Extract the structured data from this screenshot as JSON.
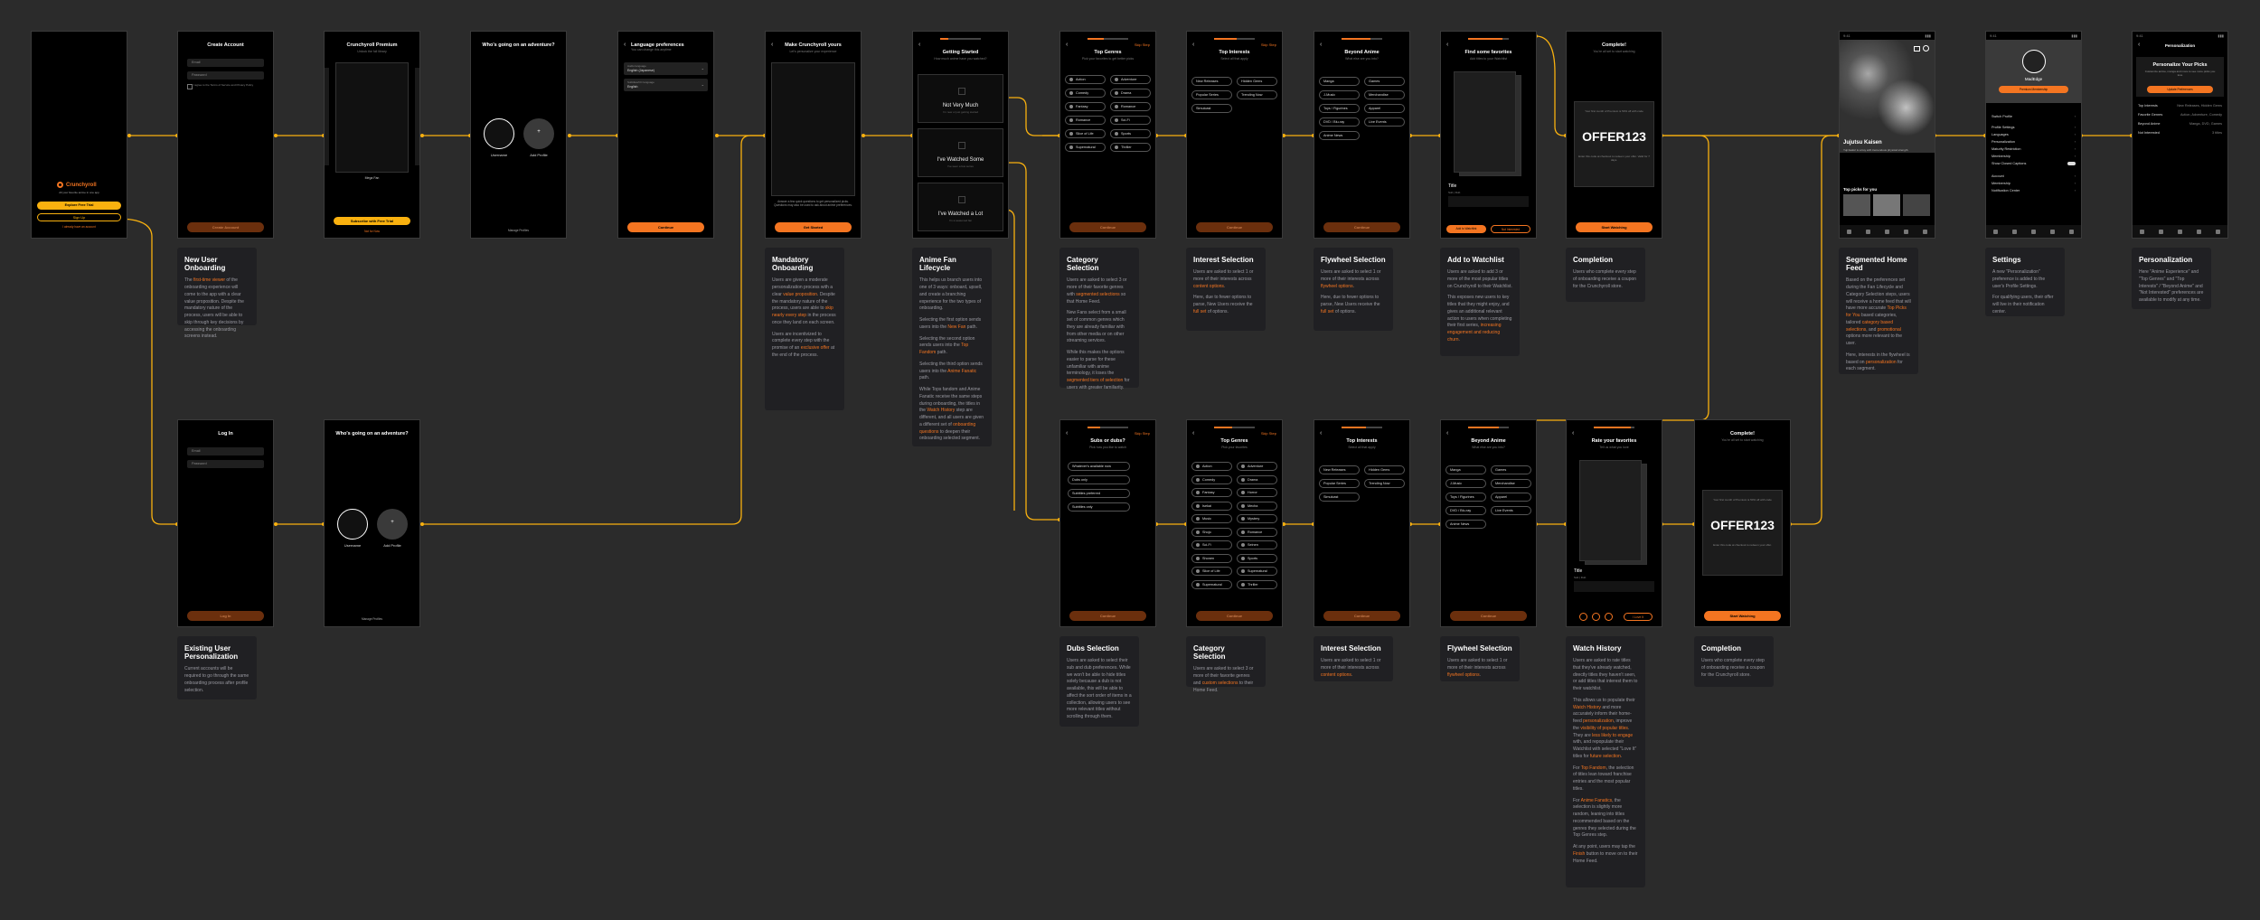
{
  "colors": {
    "bg": "#2b2b2b",
    "accent": "#f47521",
    "yellow": "#f9b10f",
    "line": "#f9b10f"
  },
  "screens": {
    "s1": {
      "brand": "Crunchyroll",
      "tagline": "All your favorite anime in one app",
      "primary": "Explore Free Trial",
      "secondary": "Sign Up",
      "link": "I already have an account"
    },
    "s2": {
      "title": "Create Account",
      "email": "Email",
      "password": "Password",
      "terms": "I agree to the Terms of Service and Privacy Policy",
      "cta": "Create Account"
    },
    "s3": {
      "title": "Crunchyroll Premium",
      "sub": "Unlock the full library",
      "plan": "Mega Fan",
      "cta": "Subscribe with Free Trial",
      "link": "Not for Now"
    },
    "s4": {
      "title": "Who's going on an adventure?",
      "u1": "Username",
      "u2": "Add Profile",
      "manage": "Manage Profiles"
    },
    "s5": {
      "title": "Language preferences",
      "sub": "You can change this anytime",
      "f1l": "Audio language",
      "f1v": "English (Japanese)",
      "f2l": "Subtitles/CC language",
      "f2v": "English",
      "cta": "Continue"
    },
    "s6": {
      "title": "Make Crunchyroll yours",
      "sub": "Let's personalize your experience",
      "body": "Answer a few quick questions to get personalized picks. Questions may also be used to ask about anime preferences.",
      "cta": "Get Started"
    },
    "s7": {
      "title": "Getting Started",
      "sub": "How much anime have you watched?",
      "o1": "Not Very Much",
      "o1s": "I'm new or just getting started",
      "o2": "I've Watched Some",
      "o2s": "I've seen a few series",
      "o3": "I've Watched a Lot",
      "o3s": "I'm a seasoned fan"
    },
    "s8": {
      "title": "Top Genres",
      "sub": "Pick your favorites to get better picks",
      "skip": "Skip Step",
      "chips": [
        "Action",
        "Adventure",
        "Comedy",
        "Drama",
        "Fantasy",
        "Romance",
        "Romance",
        "Sci-Fi",
        "Slice of Life",
        "Sports",
        "Supernatural",
        "Thriller"
      ],
      "cta": "Continue"
    },
    "s9": {
      "title": "Top Interests",
      "sub": "Select all that apply",
      "skip": "Skip Step",
      "chips": [
        "New Releases",
        "Hidden Gems",
        "Popular Series",
        "Trending Now",
        "Simulcast"
      ],
      "cta": "Continue"
    },
    "s10": {
      "title": "Beyond Anime",
      "sub": "What else are you into?",
      "chips": [
        "Manga",
        "Games",
        "J-Music",
        "Merchandise",
        "Toys / Figurines",
        "Apparel",
        "DVD / Blu-ray",
        "Live Events",
        "Anime News"
      ],
      "cta": "Continue"
    },
    "s11": {
      "title": "Find some favorites",
      "sub": "Add titles to your Watchlist",
      "ttl": "Title",
      "meta": "Sub | Dub",
      "a1": "Add to Watchlist",
      "a2": "Not Interested"
    },
    "s12": {
      "title": "Complete!",
      "sub": "You're all set to start watching",
      "o1": "Your first month of Premium is 50% off with code",
      "code": "OFFER123",
      "o2": "Enter this code at checkout to redeem your offer. Valid for 7 days.",
      "cta": "Start Watching"
    },
    "s13": {
      "show": "Jujutsu Kaisen",
      "desc": "Yuji Itadori is a boy with tremendous physical strength.",
      "row": "Top picks for you"
    },
    "s14": {
      "user": "MadEdge",
      "cta": "Premium Membership",
      "rows": [
        "Switch Profile",
        "Profile Settings",
        "Languages",
        "Personalization",
        "Maturity Restriction",
        "Membership",
        "Show Closed Captions",
        "Account",
        "Membership",
        "Notification Center"
      ]
    },
    "s15": {
      "title": "Personalization",
      "head": "Personalize Your Picks",
      "body": "Customize anime, manga and more to see more picks you love",
      "cta": "Update Preferences",
      "rows": [
        [
          "Top Interests",
          "New Releases, Hidden Gems"
        ],
        [
          "Favorite Genres",
          "Action, Adventure, Comedy"
        ],
        [
          "Beyond Anime",
          "Manga, DVD, Games"
        ],
        [
          "Not Interested",
          "3 titles"
        ]
      ]
    },
    "b1": {
      "title": "Log In",
      "email": "Email",
      "password": "Password",
      "cta": "Log In"
    },
    "b2": {
      "title": "Who's going on an adventure?",
      "u1": "Username",
      "u2": "Add Profile",
      "manage": "Manage Profiles"
    },
    "b3": {
      "title": "Subs or dubs?",
      "sub": "Pick how you like to watch",
      "skip": "Skip Step",
      "chips": [
        "Whatever's available now",
        "Dubs only",
        "Subtitles preferred",
        "Subtitles only"
      ],
      "cta": "Continue"
    },
    "b4": {
      "title": "Top Genres",
      "sub": "Pick your favorites",
      "skip": "Skip Step",
      "chips": [
        "Action",
        "Adventure",
        "Comedy",
        "Drama",
        "Fantasy",
        "Horror",
        "Isekai",
        "Mecha",
        "Music",
        "Mystery",
        "Shojo",
        "Romance",
        "Sci-Fi",
        "Seinen",
        "Shonen",
        "Sports",
        "Slice of Life",
        "Supernatural",
        "Supernatural",
        "Thriller"
      ],
      "cta": "Continue"
    },
    "b5": {
      "title": "Top Interests",
      "sub": "Select all that apply",
      "chips": [
        "New Releases",
        "Hidden Gems",
        "Popular Series",
        "Trending Now",
        "Simulcast"
      ],
      "cta": "Continue"
    },
    "b6": {
      "title": "Beyond Anime",
      "sub": "What else are you into?",
      "chips": [
        "Manga",
        "Games",
        "J-Music",
        "Merchandise",
        "Toys / Figurines",
        "Apparel",
        "DVD / Blu-ray",
        "Live Events",
        "Anime News"
      ],
      "cta": "Continue"
    },
    "b7": {
      "title": "Rate your favorites",
      "sub": "Tell us what you love",
      "ttl": "Title",
      "meta": "Sub | Dub",
      "r": "I Love It"
    },
    "b8": {
      "title": "Complete!",
      "sub": "You're all set to start watching",
      "o1": "Your first month of Premium is 50% off with code",
      "code": "OFFER123",
      "o2": "Enter this code at checkout to redeem your offer.",
      "cta": "Start Watching"
    }
  },
  "notes": {
    "n1": {
      "title": "New User Onboarding",
      "body": [
        [
          "The ",
          "",
          "first-time viewer",
          "hl",
          " of the onboarding experience will come to the app with a clear value proposition. Despite the mandatory nature of the process, users will be able to skip through key decisions by accessing the onboarding screens instead."
        ]
      ]
    },
    "n2": {
      "title": "Mandatory Onboarding",
      "body": [
        [
          "Users are given a moderate personalization process with a clear ",
          "",
          "value proposition",
          "hl",
          ". Despite the mandatory nature of the process, users are able to ",
          "",
          "skip nearly every step",
          "hl",
          " in the process once they land on each screen."
        ],
        [
          "Users are incentivized to complete every step with the promise of an ",
          "",
          "exclusive offer",
          "hl",
          " at the end of the process."
        ]
      ]
    },
    "n3": {
      "title": "Anime Fan Lifecycle",
      "body": [
        [
          "This helps us branch users into one of 3 ways: onboard, upsell, and create a branching experience for the two types of onboarding.",
          "",
          "",
          "",
          ""
        ],
        [
          "Selecting the first option sends users into the ",
          "",
          "New Fan",
          "hl",
          " path."
        ],
        [
          "Selecting the second option sends users into the ",
          "",
          "Top Fandom",
          "hl",
          " path."
        ],
        [
          "Selecting the third option sends users into the ",
          "",
          "Anime Fanatic",
          "hl",
          " path."
        ],
        [
          "While Tops fandom and Anime Fanatic receive the same steps during onboarding, the titles in the ",
          "",
          "Watch History",
          "hl",
          " step are different, and all users are given a different set of ",
          "",
          "onboarding questions",
          "hl",
          " to deepen their onboarding selected segment."
        ]
      ]
    },
    "n4": {
      "title": "Category Selection",
      "body": [
        [
          "Users are asked to select 3 or more of their favorite genres with ",
          "",
          "segmented selections",
          "hl",
          " so that Home Feed."
        ],
        [
          "New Fans select from a small set of common genres which they are already familiar with from other media or on other streaming services."
        ],
        [
          "While this makes the options easier to parse for these unfamiliar with anime terminology, it loses the ",
          "",
          "segmented tiers of selection",
          "hl",
          " for users with greater familiarity."
        ]
      ]
    },
    "n5": {
      "title": "Interest Selection",
      "body": [
        [
          "Users are asked to select 1 or more of their interests across ",
          "",
          "content options",
          "hl",
          "."
        ],
        [
          "Here, due to fewer options to parse, New Users receive the ",
          "",
          "full set",
          "hl",
          " of options."
        ]
      ]
    },
    "n6": {
      "title": "Flywheel Selection",
      "body": [
        [
          "Users are asked to select 1 or more of their interests across ",
          "",
          "flywheel options",
          "hl",
          "."
        ],
        [
          "Here, due to fewer options to parse, New Users receive the ",
          "",
          "full set",
          "hl",
          " of options."
        ]
      ]
    },
    "n7": {
      "title": "Add to Watchlist",
      "body": [
        [
          "Users are asked to add 3 or more of the most popular titles on Crunchyroll to their Watchlist."
        ],
        [
          "This exposes new users to key titles that they might enjoy, and gives an additional relevant action to users when completing their first series, ",
          "",
          "increasing engagement and reducing churn",
          "hl",
          "."
        ]
      ]
    },
    "n8": {
      "title": "Completion",
      "body": [
        [
          "Users who complete every step of onboarding receive a coupon for the Crunchyroll store."
        ]
      ]
    },
    "n9": {
      "title": "Segmented Home Feed",
      "body": [
        [
          "Based on the preferences set during the Fan Lifecycle and Category Selection steps, users will receive a home feed that will have more accurate ",
          "",
          "Top Picks for You",
          "hl",
          " based categories, tailored ",
          "",
          "category based selections",
          "hl",
          ", and ",
          "",
          "promotional",
          "hl",
          " options more relevant to the user."
        ],
        [
          "Here, interests in the flywheel is based on ",
          "",
          "personalization",
          "hl",
          " for each segment."
        ]
      ]
    },
    "n10": {
      "title": "Settings",
      "body": [
        [
          "A new \"Personalization\" preference is added to the user's Profile Settings."
        ],
        [
          "For qualifying users, their offer will live in their notification center."
        ]
      ]
    },
    "n11": {
      "title": "Personalization",
      "body": [
        [
          "Here \"Anime Experience\" and \"Top Genres\" and \"Top Interests\" / \"Beyond Anime\" and \"Not Interested\" preferences are available to modify at any time."
        ]
      ]
    },
    "n12": {
      "title": "Existing User Personalization",
      "body": [
        [
          "Current accounts will be required to go through the same onboarding process after profile selection."
        ]
      ]
    },
    "n13": {
      "title": "Dubs Selection",
      "body": [
        [
          "Users are asked to select their sub and dub preferences. While we won't be able to hide titles solely because a dub is not available, this will be able to affect the sort order of items in a collection, allowing users to see more relevant titles without scrolling through them."
        ]
      ]
    },
    "n14": {
      "title": "Category Selection",
      "body": [
        [
          "Users are asked to select 3 or more of their favorite genres and ",
          "",
          "custom selections",
          "hl",
          " to their Home Feed."
        ]
      ]
    },
    "n15": {
      "title": "Interest Selection",
      "body": [
        [
          "Users are asked to select 1 or more of their interests across ",
          "",
          "content options",
          "hl",
          "."
        ]
      ]
    },
    "n16": {
      "title": "Flywheel Selection",
      "body": [
        [
          "Users are asked to select 1 or more of their interests across ",
          "",
          "flywheel options",
          "hl",
          "."
        ]
      ]
    },
    "n17": {
      "title": "Watch History",
      "body": [
        [
          "Users are asked to rate titles that they've already watched, directly titles they haven't seen, or add titles that interest them to their watchlist."
        ],
        [
          "This allows us to populate their ",
          "",
          "Watch History",
          "hl",
          " and more accurately inform their home-feed ",
          "",
          "personalization",
          "hl",
          ", improve the ",
          "",
          "visibility of popular titles",
          "hl",
          ". They are ",
          "",
          "less likely to engage",
          "hl",
          " with, and repopulate their Watchlist with selected \"Love It\" titles for ",
          "",
          "future selection",
          "hl",
          "."
        ],
        [
          "For ",
          "",
          "Top Fandom",
          "hl",
          ", the selection of titles lean toward franchise entries and the most popular titles."
        ],
        [
          "For ",
          "",
          "Anime Fanatics",
          "hl",
          ", the selection is slightly more random, leaning into titles recommended based on the genres they selected during the Top Genres step."
        ],
        [
          "At any point, users may tap the ",
          "",
          "Finish",
          "hl",
          " button to move on to their Home Feed."
        ]
      ]
    },
    "n18": {
      "title": "Completion",
      "body": [
        [
          "Users who complete every step of onboarding receive a coupon for the Crunchyroll store."
        ]
      ]
    }
  }
}
